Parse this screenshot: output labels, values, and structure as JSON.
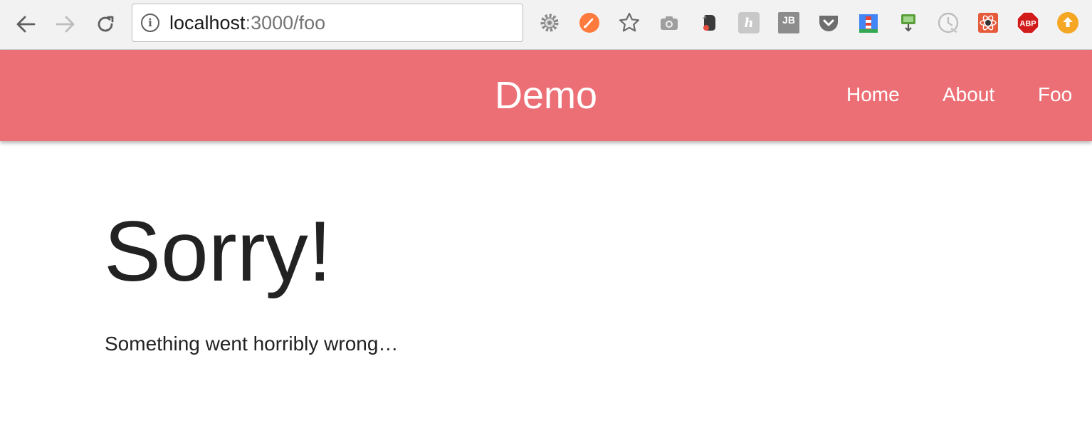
{
  "browser": {
    "url_host": "localhost",
    "url_path": ":3000/foo",
    "nav_icons": [
      "back-arrow-icon",
      "forward-arrow-icon",
      "reload-icon"
    ],
    "extensions": [
      {
        "name": "settings-gear-icon",
        "label": "",
        "color": "#8a8a8a"
      },
      {
        "name": "brush-icon",
        "label": "",
        "color": "#ff7a3d"
      },
      {
        "name": "star-icon",
        "label": "",
        "color": "#6b6b6b"
      },
      {
        "name": "camera-icon",
        "label": "",
        "color": "#9e9e9e"
      },
      {
        "name": "evernote-icon",
        "label": "",
        "color": "#3b3b3b"
      },
      {
        "name": "h-extension-icon",
        "label": "h",
        "color": "#c8c8c8"
      },
      {
        "name": "jetbrains-icon",
        "label": "JB",
        "color": "#8c8c8c"
      },
      {
        "name": "pocket-icon",
        "label": "",
        "color": "#6e6e6e"
      },
      {
        "name": "lighthouse-icon",
        "label": "",
        "color": "#4285f4"
      },
      {
        "name": "download-icon",
        "label": "",
        "color": "#5a9e3a"
      },
      {
        "name": "clock-icon",
        "label": "",
        "color": "#bdbdbd"
      },
      {
        "name": "react-devtools-icon",
        "label": "",
        "color": "#e55b3c"
      },
      {
        "name": "adblock-icon",
        "label": "ABP",
        "color": "#d21c1c"
      },
      {
        "name": "upload-icon",
        "label": "",
        "color": "#f5a623"
      }
    ]
  },
  "header": {
    "brand": "Demo",
    "nav": [
      {
        "label": "Home"
      },
      {
        "label": "About"
      },
      {
        "label": "Foo"
      }
    ],
    "color": "#ec6f75"
  },
  "content": {
    "title": "Sorry!",
    "message": "Something went horribly wrong…"
  }
}
